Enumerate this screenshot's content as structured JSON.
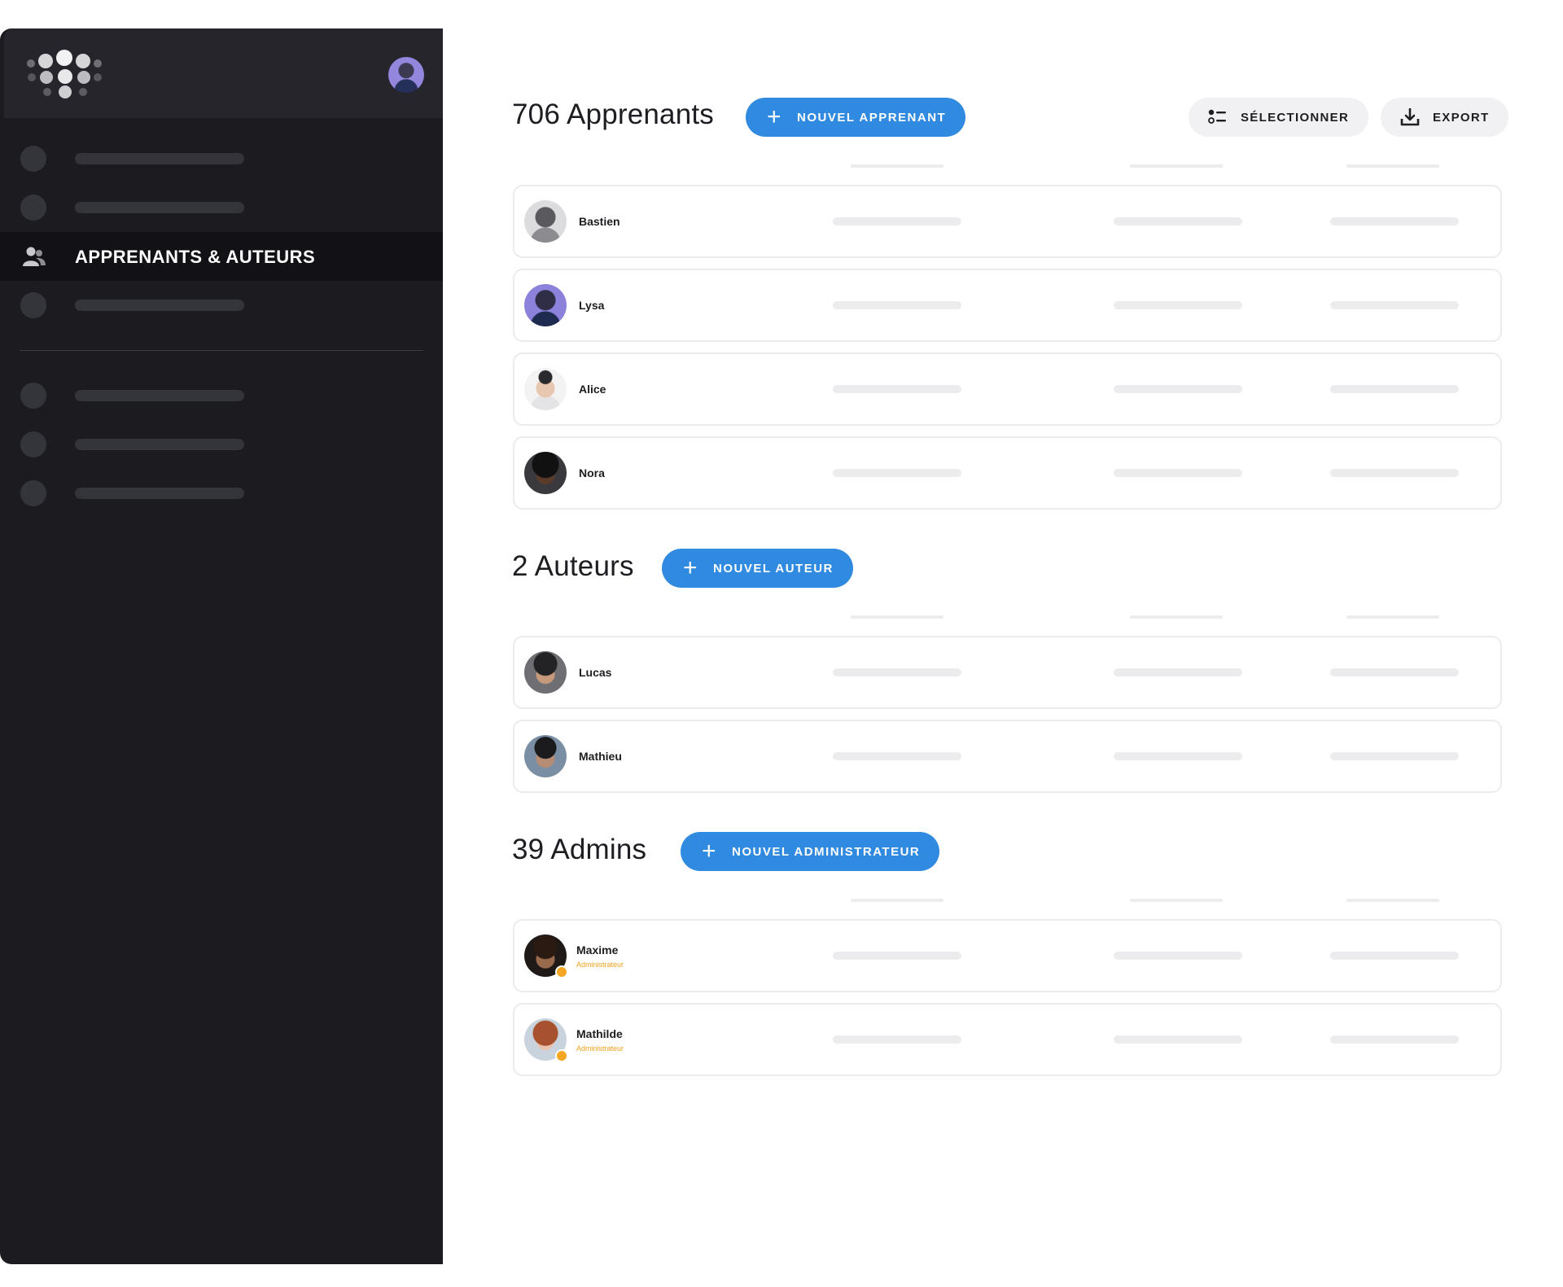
{
  "sidebar": {
    "active_item": {
      "label": "APPRENANTS & AUTEURS",
      "icon": "people-icon"
    }
  },
  "colors": {
    "sidebar_bg": "#1b1b20",
    "sidebar_header_bg": "#25252b",
    "accent": "#2f8ae0",
    "admin_accent": "#f0a019"
  },
  "toolbar": {
    "select_label": "SÉLECTIONNER",
    "select_icon": "list-select-icon",
    "export_label": "EXPORT",
    "export_icon": "download-icon"
  },
  "sections": [
    {
      "title": "706 Apprenants",
      "button": "NOUVEL APPRENANT",
      "rows": [
        {
          "name": "Bastien"
        },
        {
          "name": "Lysa"
        },
        {
          "name": "Alice"
        },
        {
          "name": "Nora"
        }
      ]
    },
    {
      "title": "2 Auteurs",
      "button": "NOUVEL AUTEUR",
      "rows": [
        {
          "name": "Lucas"
        },
        {
          "name": "Mathieu"
        }
      ]
    },
    {
      "title": "39 Admins",
      "button": "NOUVEL ADMINISTRATEUR",
      "rows": [
        {
          "name": "Maxime",
          "role": "Administrateur"
        },
        {
          "name": "Mathilde",
          "role": "Administrateur"
        }
      ]
    }
  ]
}
